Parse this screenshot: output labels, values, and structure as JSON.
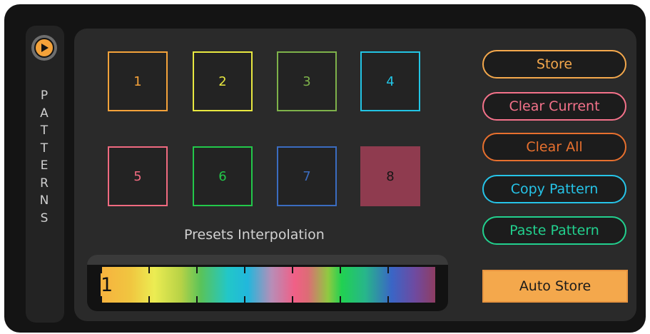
{
  "sidebar": {
    "title_letters": [
      "P",
      "A",
      "T",
      "T",
      "E",
      "R",
      "N",
      "S"
    ]
  },
  "pads": [
    {
      "label": "1",
      "color": "#f4a23a",
      "filled": false
    },
    {
      "label": "2",
      "color": "#e8e840",
      "filled": false
    },
    {
      "label": "3",
      "color": "#7eb24a",
      "filled": false
    },
    {
      "label": "4",
      "color": "#22c4e4",
      "filled": false
    },
    {
      "label": "5",
      "color": "#f06a80",
      "filled": false
    },
    {
      "label": "6",
      "color": "#22c84a",
      "filled": false
    },
    {
      "label": "7",
      "color": "#3b6cc0",
      "filled": false
    },
    {
      "label": "8",
      "color": "#8f3b4f",
      "filled": true
    }
  ],
  "buttons": {
    "store": {
      "label": "Store",
      "color": "#f4a84c"
    },
    "clear_current": {
      "label": "Clear Current",
      "color": "#f4728a"
    },
    "clear_all": {
      "label": "Clear All",
      "color": "#e8702e"
    },
    "copy_pattern": {
      "label": "Copy Pattern",
      "color": "#26c4e8"
    },
    "paste_pattern": {
      "label": "Paste Pattern",
      "color": "#22d08e"
    },
    "auto_store": {
      "label": "Auto Store",
      "color": "#f4a84c"
    }
  },
  "interpolation": {
    "label": "Presets Interpolation",
    "value": "1"
  }
}
